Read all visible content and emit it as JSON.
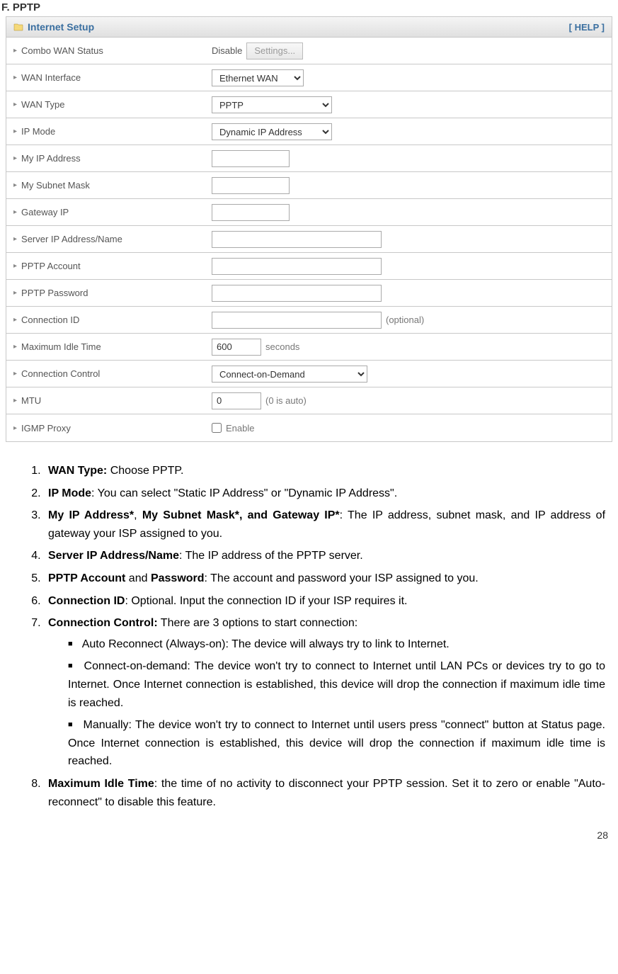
{
  "page_title": "F. PPTP",
  "panel": {
    "title": "Internet Setup",
    "help": "[ HELP ]"
  },
  "rows": {
    "combo_wan_status": {
      "label": "Combo WAN Status",
      "value": "Disable",
      "button": "Settings..."
    },
    "wan_interface": {
      "label": "WAN Interface",
      "value": "Ethernet WAN"
    },
    "wan_type": {
      "label": "WAN Type",
      "value": "PPTP"
    },
    "ip_mode": {
      "label": "IP Mode",
      "value": "Dynamic IP Address"
    },
    "my_ip": {
      "label": "My IP Address",
      "value": ""
    },
    "my_subnet": {
      "label": "My Subnet Mask",
      "value": ""
    },
    "gateway_ip": {
      "label": "Gateway IP",
      "value": ""
    },
    "server_ip": {
      "label": "Server IP Address/Name",
      "value": ""
    },
    "pptp_account": {
      "label": "PPTP Account",
      "value": ""
    },
    "pptp_password": {
      "label": "PPTP Password",
      "value": ""
    },
    "connection_id": {
      "label": "Connection ID",
      "value": "",
      "hint": "(optional)"
    },
    "max_idle": {
      "label": "Maximum Idle Time",
      "value": "600",
      "unit": "seconds"
    },
    "connection_control": {
      "label": "Connection Control",
      "value": "Connect-on-Demand"
    },
    "mtu": {
      "label": "MTU",
      "value": "0",
      "hint": "(0 is auto)"
    },
    "igmp": {
      "label": "IGMP Proxy",
      "checkbox_label": "Enable"
    }
  },
  "doc": {
    "li1_b": "WAN Type:",
    "li1_t": " Choose PPTP.",
    "li2_b": "IP Mode",
    "li2_t": ": You can select \"Static IP Address\" or \"Dynamic IP Address\".",
    "li3_b1": "My IP Address*",
    "li3_m": ", ",
    "li3_b2": "My Subnet Mask*, and Gateway IP*",
    "li3_t": ": The IP address, subnet mask, and IP address of gateway your ISP assigned to you.",
    "li4_b": "Server IP Address/Name",
    "li4_t": ": The IP address of the PPTP server.",
    "li5_b1": "PPTP Account",
    "li5_m": " and ",
    "li5_b2": "Password",
    "li5_t": ": The account and password your ISP assigned to you.",
    "li6_b": "Connection ID",
    "li6_t": ": Optional. Input the connection ID if your ISP requires it.",
    "li7_b": "Connection Control:",
    "li7_t": " There are 3 options to start connection:",
    "li7_s1": "Auto Reconnect (Always-on): The device will always try to link to Internet.",
    "li7_s2": "Connect-on-demand: The device won't try to connect to Internet until LAN PCs or devices try to go to Internet. Once Internet connection is established, this device will drop the connection if maximum idle time is reached.",
    "li7_s3": "Manually: The device won't try to connect to Internet until users press \"connect\" button at Status page. Once Internet connection is established, this device will drop the connection if maximum idle time is reached.",
    "li8_b": "Maximum Idle Time",
    "li8_t": ": the time of no activity to disconnect your PPTP session. Set it to zero or enable \"Auto-reconnect\" to disable this feature."
  },
  "page_number": "28"
}
